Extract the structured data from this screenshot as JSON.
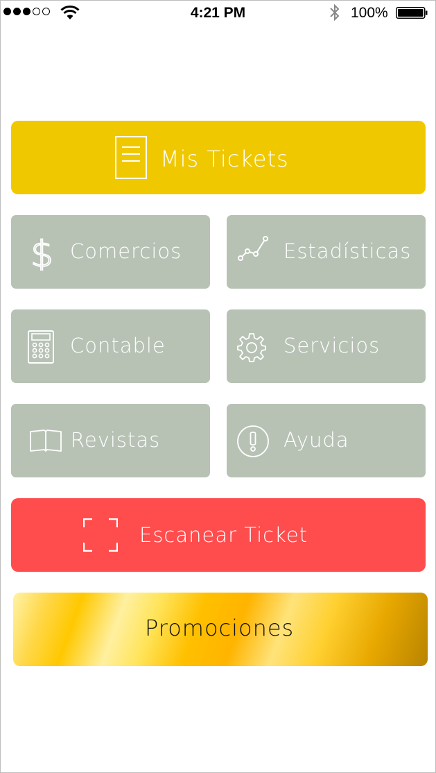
{
  "status_bar": {
    "time": "4:21 PM",
    "battery_percent": "100%",
    "signal_bars": 3,
    "signal_total": 5
  },
  "menu": {
    "mis_tickets": "Mis Tickets",
    "comercios": "Comercios",
    "estadisticas": "Estadísticas",
    "contable": "Contable",
    "servicios": "Servicios",
    "revistas": "Revistas",
    "ayuda": "Ayuda",
    "escanear_ticket": "Escanear Ticket",
    "promociones": "Promociones"
  },
  "colors": {
    "mis_tickets_bg": "#f0c800",
    "gray_tile_bg": "#b7c2b5",
    "escanear_bg": "#ff4c4d",
    "promociones_gold": "#ffc800"
  },
  "icons": {
    "mis_tickets": "document-icon",
    "comercios": "dollar-icon",
    "estadisticas": "line-chart-icon",
    "contable": "calculator-icon",
    "servicios": "gear-icon",
    "revistas": "open-book-icon",
    "ayuda": "exclamation-circle-icon",
    "escanear_ticket": "scan-frame-icon"
  }
}
